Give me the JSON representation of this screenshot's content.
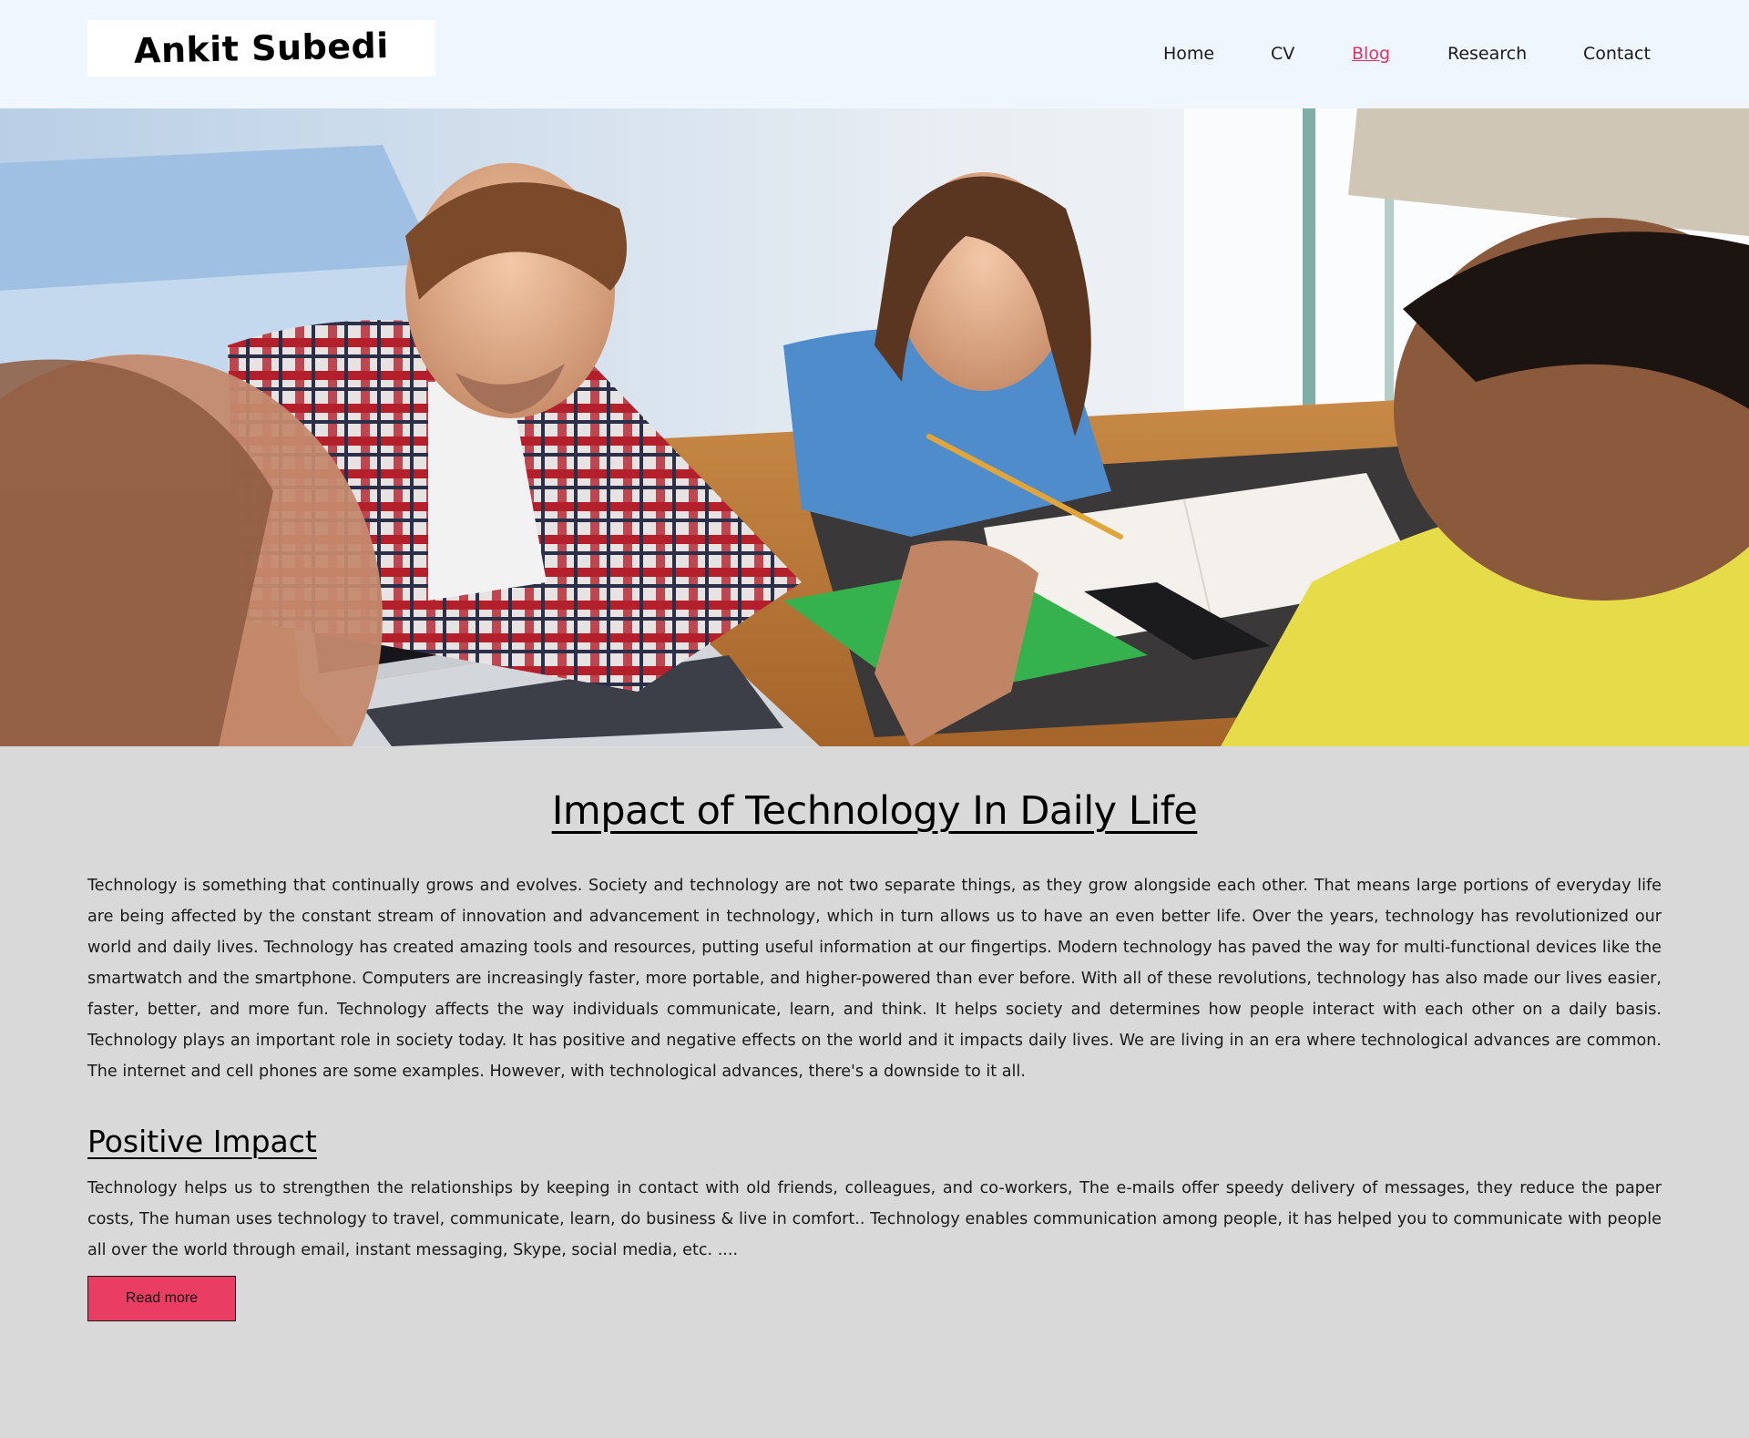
{
  "header": {
    "logo_text": "Ankit Subedi",
    "background": "#eff6fe"
  },
  "nav": {
    "items": [
      {
        "label": "Home",
        "active": false
      },
      {
        "label": "CV",
        "active": false
      },
      {
        "label": "Blog",
        "active": true
      },
      {
        "label": "Research",
        "active": false
      },
      {
        "label": "Contact",
        "active": false
      }
    ],
    "active_color": "#e0335f"
  },
  "hero": {
    "subject": "four people collaborating at a table with a laptop, notebook, pencil and smartphone"
  },
  "post": {
    "title": "Impact of Technology In Daily Life",
    "intro": "Technology is something that continually grows and evolves. Society and technology are not two separate things, as they grow alongside each other. That means large portions of everyday life are being affected by the constant stream of innovation and advancement in technology, which in turn allows us to have an even better life. Over the years, technology has revolutionized our world and daily lives. Technology has created amazing tools and resources, putting useful information at our fingertips. Modern technology has paved the way for multi-functional devices like the smartwatch and the smartphone. Computers are increasingly faster, more portable, and higher-powered than ever before. With all of these revolutions, technology has also made our lives easier, faster, better, and more fun. Technology affects the way individuals communicate, learn, and think. It helps society and determines how people interact with each other on a daily basis. Technology plays an important role in society today. It has positive and negative effects on the world and it impacts daily lives. We are living in an era where technological advances are common. The internet and cell phones are some examples. However, with technological advances, there's a downside to it all.",
    "section_heading": "Positive Impact",
    "section_text": "Technology helps us to strengthen the relationships by keeping in contact with old friends, colleagues, and co-workers, The e-mails offer speedy delivery of messages, they reduce the paper costs, The human uses technology to travel, communicate, learn, do business & live in comfort.. Technology enables communication among people, it has helped you to communicate with people all over the world through email, instant messaging, Skype, social media, etc. ....",
    "read_more_label": "Read more",
    "button_color": "#ea3d63"
  },
  "page": {
    "background": "#d9d9d9"
  }
}
